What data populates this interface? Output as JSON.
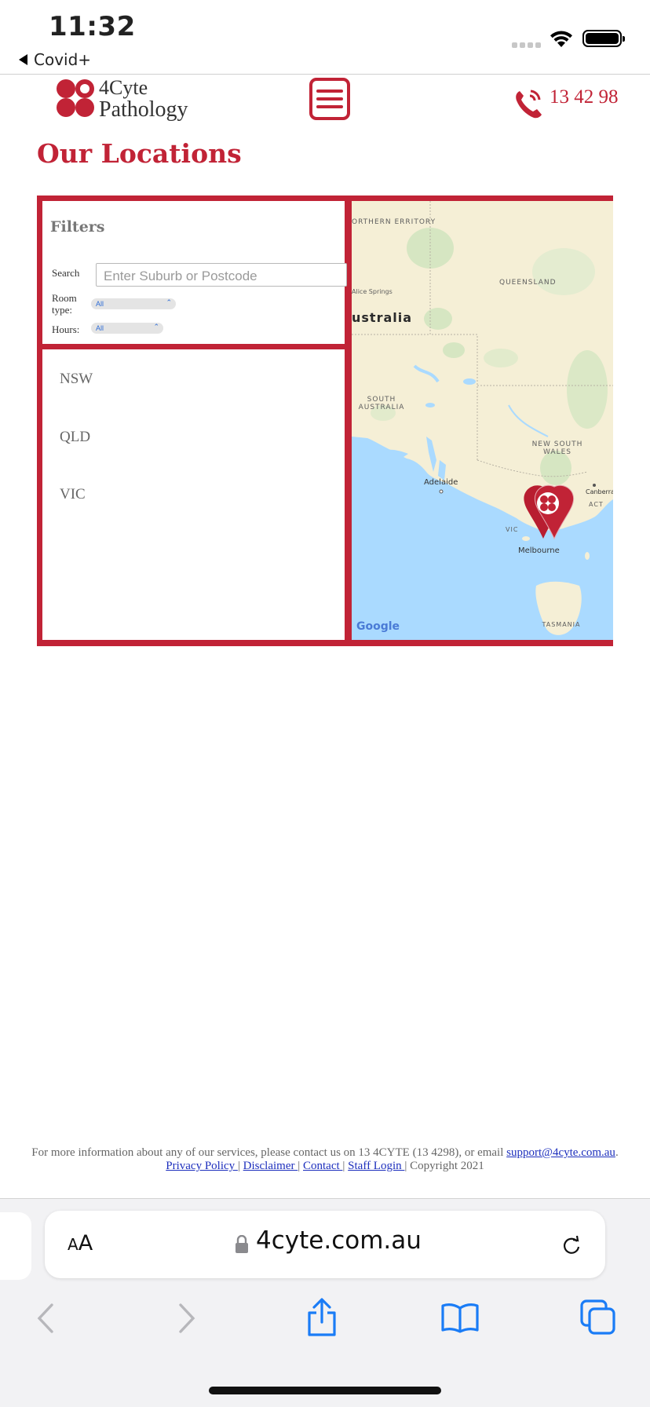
{
  "status_bar": {
    "time": "11:32",
    "back_app": "Covid+"
  },
  "header": {
    "logo_line1": "4Cyte",
    "logo_line2": "Pathology",
    "phone": "13 42 98",
    "brand_color": "#c12336"
  },
  "page": {
    "title": "Our Locations"
  },
  "filters": {
    "title": "Filters",
    "search_label": "Search",
    "search_placeholder": "Enter Suburb or Postcode",
    "room_type_label": "Room type:",
    "room_type_value": "All",
    "hours_label": "Hours:",
    "hours_value": "All"
  },
  "states": [
    "NSW",
    "QLD",
    "VIC"
  ],
  "map": {
    "labels": {
      "nt": "ORTHERN\nERRITORY",
      "alice": "Alice Springs",
      "australia": "ustralia",
      "qld": "QUEENSLAND",
      "sa": "SOUTH\nAUSTRALIA",
      "nsw": "NEW SOUTH\nWALES",
      "adelaide": "Adelaide",
      "canberra": "Canberra",
      "act": "ACT",
      "vic": "VIC",
      "melbourne": "Melbourne",
      "tasmania": "TASMANIA",
      "google": "Google"
    }
  },
  "footer": {
    "info_prefix": "For more information about any of our services, please contact us on 13 4CYTE (13 4298), or email ",
    "email": "support@4cyte.com.au",
    "info_suffix": ".",
    "links": {
      "privacy": "Privacy Policy ",
      "disclaimer": "Disclaimer ",
      "contact": "Contact ",
      "staff": "Staff Login ",
      "separator": "|",
      "copyright": "Copyright 2021"
    }
  },
  "browser": {
    "aa_small": "A",
    "aa_big": "A",
    "url": "4cyte.com.au"
  }
}
